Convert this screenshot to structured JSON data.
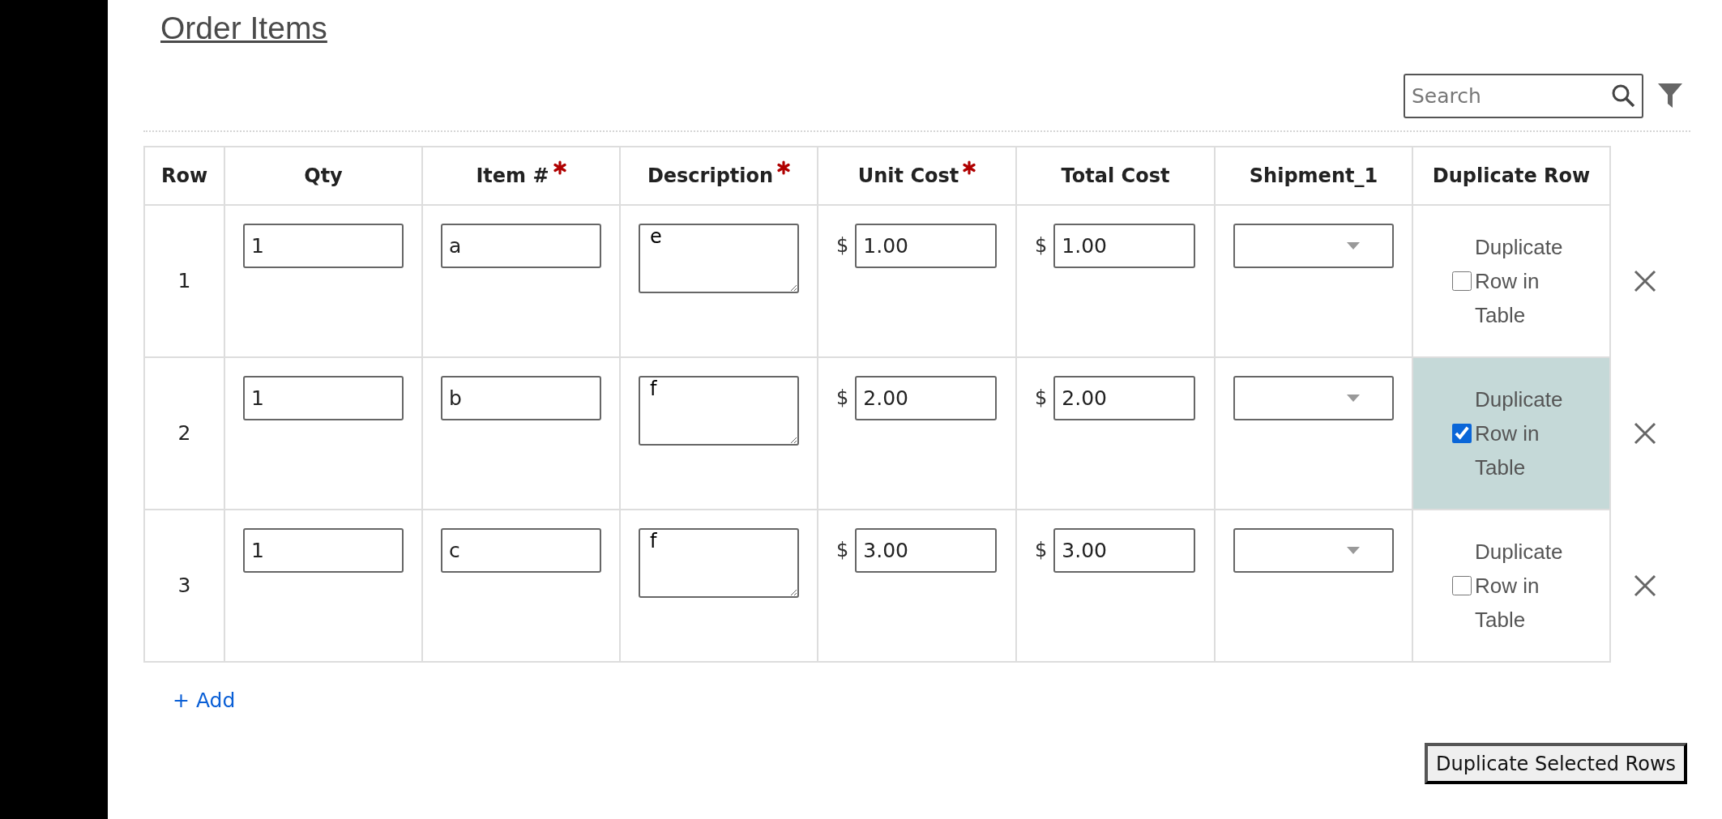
{
  "section_title": "Order Items",
  "search": {
    "placeholder": "Search"
  },
  "table": {
    "columns": [
      {
        "label": "Row",
        "required": false
      },
      {
        "label": "Qty",
        "required": false
      },
      {
        "label": "Item #",
        "required": true
      },
      {
        "label": "Description",
        "required": true
      },
      {
        "label": "Unit Cost",
        "required": true
      },
      {
        "label": "Total Cost",
        "required": false
      },
      {
        "label": "Shipment_1",
        "required": false
      },
      {
        "label": "Duplicate Row",
        "required": false
      }
    ],
    "rows": [
      {
        "row": "1",
        "qty": "1",
        "item": "a",
        "description": "e",
        "unit_cost": {
          "currency": "$",
          "value": "1.00"
        },
        "total_cost": {
          "currency": "$",
          "value": "1.00"
        },
        "duplicate": {
          "label": "Duplicate Row in Table",
          "checked": false
        }
      },
      {
        "row": "2",
        "qty": "1",
        "item": "b",
        "description": "f",
        "unit_cost": {
          "currency": "$",
          "value": "2.00"
        },
        "total_cost": {
          "currency": "$",
          "value": "2.00"
        },
        "duplicate": {
          "label": "Duplicate Row in Table",
          "checked": true
        }
      },
      {
        "row": "3",
        "qty": "1",
        "item": "c",
        "description": "f",
        "unit_cost": {
          "currency": "$",
          "value": "3.00"
        },
        "total_cost": {
          "currency": "$",
          "value": "3.00"
        },
        "duplicate": {
          "label": "Duplicate Row in Table",
          "checked": false
        }
      }
    ]
  },
  "add_link": "+ Add",
  "duplicate_button": "Duplicate Selected Rows"
}
